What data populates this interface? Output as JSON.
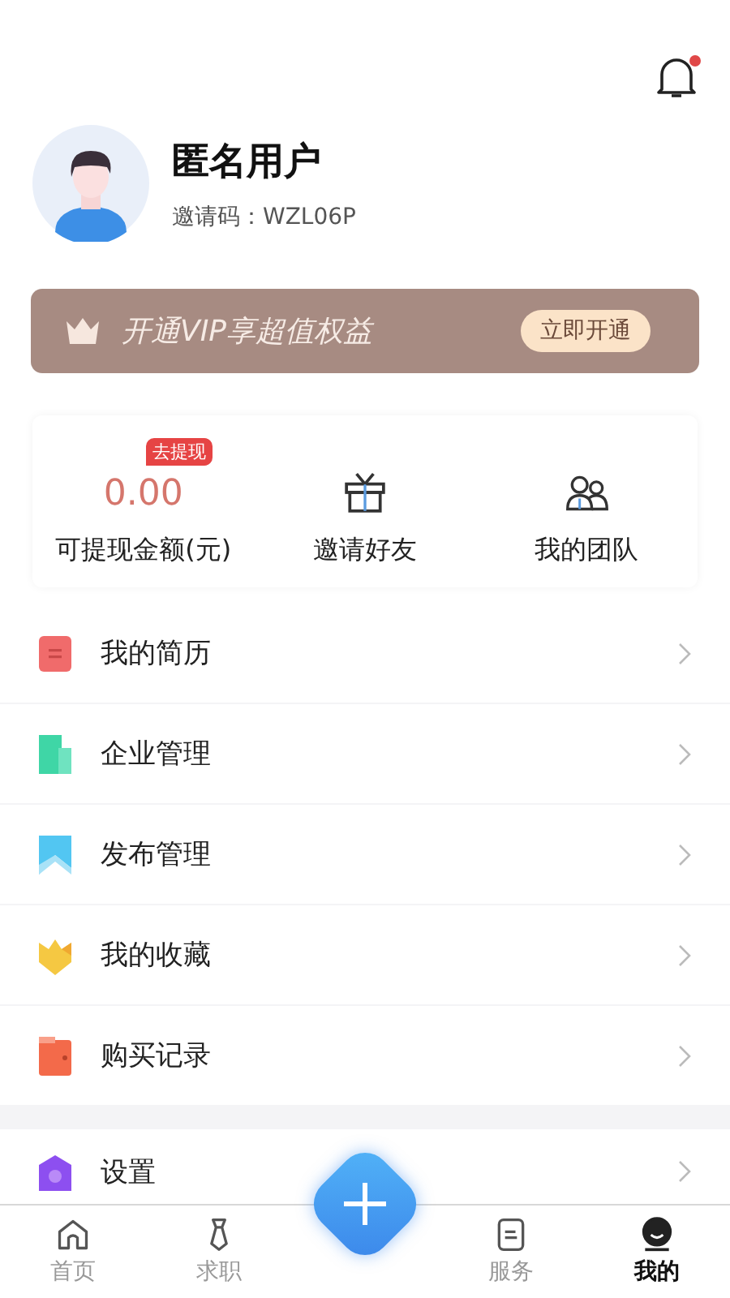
{
  "header": {
    "notification_badge": true
  },
  "profile": {
    "name": "匿名用户",
    "invite_label": "邀请码：",
    "invite_code": "WZL06P"
  },
  "vip_banner": {
    "text": "开通VIP享超值权益",
    "button": "立即开通"
  },
  "stats": [
    {
      "kind": "amount",
      "value": "0.00",
      "badge": "去提现",
      "label": "可提现金额(元)"
    },
    {
      "kind": "gift",
      "label": "邀请好友"
    },
    {
      "kind": "team",
      "label": "我的团队"
    }
  ],
  "menu": [
    {
      "kind": "resume",
      "label": "我的简历"
    },
    {
      "kind": "company",
      "label": "企业管理"
    },
    {
      "kind": "publish",
      "label": "发布管理"
    },
    {
      "kind": "favorite",
      "label": "我的收藏"
    },
    {
      "kind": "purchase",
      "label": "购买记录"
    }
  ],
  "menu2": [
    {
      "kind": "settings",
      "label": "设置"
    }
  ],
  "tabs": [
    {
      "kind": "home",
      "label": "首页",
      "selected": false
    },
    {
      "kind": "job",
      "label": "求职",
      "selected": false
    },
    {
      "kind": "add",
      "selected": false
    },
    {
      "kind": "service",
      "label": "服务",
      "selected": false
    },
    {
      "kind": "me",
      "label": "我的",
      "selected": true
    }
  ]
}
